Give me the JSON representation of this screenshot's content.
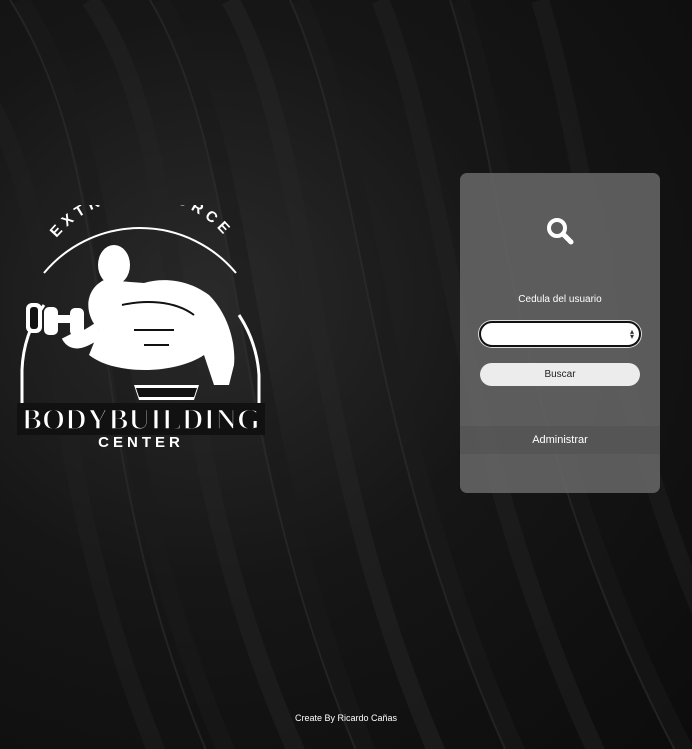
{
  "logo": {
    "top_text": "EXTREME FORCE",
    "main_text": "BODYBUILDING",
    "sub_text": "CENTER"
  },
  "search_panel": {
    "icon": "search-icon",
    "field_label": "Cedula del usuario",
    "input_value": "",
    "search_button_label": "Buscar",
    "admin_label": "Administrar"
  },
  "footer": {
    "credit": "Create By Ricardo Cañas"
  }
}
